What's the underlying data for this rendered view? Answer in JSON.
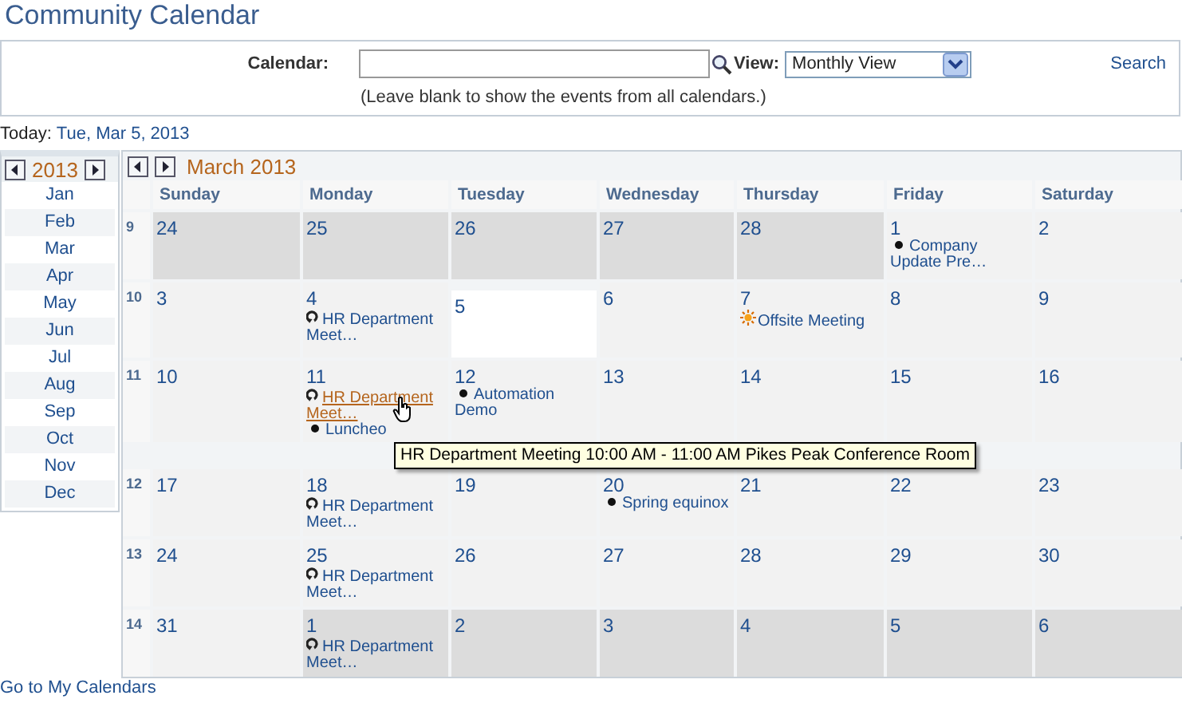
{
  "title": "Community Calendar",
  "search": {
    "calendar_label": "Calendar:",
    "view_label": "View:",
    "view_value": "Monthly View",
    "search_link": "Search",
    "hint": "(Leave blank to show the events from all calendars.)"
  },
  "today": {
    "label": "Today:",
    "date": "Tue, Mar 5, 2013"
  },
  "year_panel": {
    "year": "2013",
    "months": [
      "Jan",
      "Feb",
      "Mar",
      "Apr",
      "May",
      "Jun",
      "Jul",
      "Aug",
      "Sep",
      "Oct",
      "Nov",
      "Dec"
    ]
  },
  "month": {
    "title": "March 2013",
    "weekdays": [
      "Sunday",
      "Monday",
      "Tuesday",
      "Wednesday",
      "Thursday",
      "Friday",
      "Saturday"
    ],
    "weeks": [
      {
        "number": "9",
        "days": [
          {
            "day": "24",
            "other_month": true,
            "today": false
          },
          {
            "day": "25",
            "other_month": true,
            "today": false
          },
          {
            "day": "26",
            "other_month": true,
            "today": false
          },
          {
            "day": "27",
            "other_month": true,
            "today": false
          },
          {
            "day": "28",
            "other_month": true,
            "today": false
          },
          {
            "day": "1",
            "other_month": false,
            "today": false,
            "events": [
              {
                "kind": "single",
                "text": "Company Update Pre…",
                "hovered": false
              }
            ]
          },
          {
            "day": "2",
            "other_month": false,
            "today": false
          }
        ]
      },
      {
        "number": "10",
        "days": [
          {
            "day": "3",
            "other_month": false,
            "today": false
          },
          {
            "day": "4",
            "other_month": false,
            "today": false,
            "events": [
              {
                "kind": "recurring",
                "text": "HR Department Meet…",
                "hovered": false
              }
            ]
          },
          {
            "day": "5",
            "other_month": false,
            "today": true
          },
          {
            "day": "6",
            "other_month": false,
            "today": false
          },
          {
            "day": "7",
            "other_month": false,
            "today": false,
            "events": [
              {
                "kind": "all_day",
                "text": "Offsite Meeting",
                "hovered": false
              }
            ]
          },
          {
            "day": "8",
            "other_month": false,
            "today": false
          },
          {
            "day": "9",
            "other_month": false,
            "today": false
          }
        ]
      },
      {
        "number": "11",
        "days": [
          {
            "day": "10",
            "other_month": false,
            "today": false
          },
          {
            "day": "11",
            "other_month": false,
            "today": false,
            "events": [
              {
                "kind": "recurring",
                "text": "HR Department Meet…",
                "hovered": true
              },
              {
                "kind": "single",
                "text": "Luncheo",
                "hovered": false
              }
            ]
          },
          {
            "day": "12",
            "other_month": false,
            "today": false,
            "events": [
              {
                "kind": "single",
                "text": "Automation Demo",
                "hovered": false
              }
            ]
          },
          {
            "day": "13",
            "other_month": false,
            "today": false
          },
          {
            "day": "14",
            "other_month": false,
            "today": false
          },
          {
            "day": "15",
            "other_month": false,
            "today": false
          },
          {
            "day": "16",
            "other_month": false,
            "today": false
          }
        ]
      },
      {
        "number": "12",
        "days": [
          {
            "day": "17",
            "other_month": false,
            "today": false
          },
          {
            "day": "18",
            "other_month": false,
            "today": false,
            "events": [
              {
                "kind": "recurring",
                "text": "HR Department Meet…",
                "hovered": false
              }
            ]
          },
          {
            "day": "19",
            "other_month": false,
            "today": false
          },
          {
            "day": "20",
            "other_month": false,
            "today": false,
            "events": [
              {
                "kind": "single",
                "text": "Spring equinox",
                "hovered": false
              }
            ]
          },
          {
            "day": "21",
            "other_month": false,
            "today": false
          },
          {
            "day": "22",
            "other_month": false,
            "today": false
          },
          {
            "day": "23",
            "other_month": false,
            "today": false
          }
        ]
      },
      {
        "number": "13",
        "days": [
          {
            "day": "24",
            "other_month": false,
            "today": false
          },
          {
            "day": "25",
            "other_month": false,
            "today": false,
            "events": [
              {
                "kind": "recurring",
                "text": "HR Department Meet…",
                "hovered": false
              }
            ]
          },
          {
            "day": "26",
            "other_month": false,
            "today": false
          },
          {
            "day": "27",
            "other_month": false,
            "today": false
          },
          {
            "day": "28",
            "other_month": false,
            "today": false
          },
          {
            "day": "29",
            "other_month": false,
            "today": false
          },
          {
            "day": "30",
            "other_month": false,
            "today": false
          }
        ]
      },
      {
        "number": "14",
        "days": [
          {
            "day": "31",
            "other_month": false,
            "today": false
          },
          {
            "day": "1",
            "other_month": true,
            "today": false,
            "events": [
              {
                "kind": "recurring",
                "text": "HR Department Meet…",
                "hovered": false
              }
            ]
          },
          {
            "day": "2",
            "other_month": true,
            "today": false
          },
          {
            "day": "3",
            "other_month": true,
            "today": false
          },
          {
            "day": "4",
            "other_month": true,
            "today": false
          },
          {
            "day": "5",
            "other_month": true,
            "today": false
          },
          {
            "day": "6",
            "other_month": true,
            "today": false
          }
        ]
      }
    ]
  },
  "tooltip": {
    "text": "HR Department Meeting 10:00 AM - 11:00 AM Pikes Peak Conference Room"
  },
  "footer_link": "Go to My Calendars"
}
